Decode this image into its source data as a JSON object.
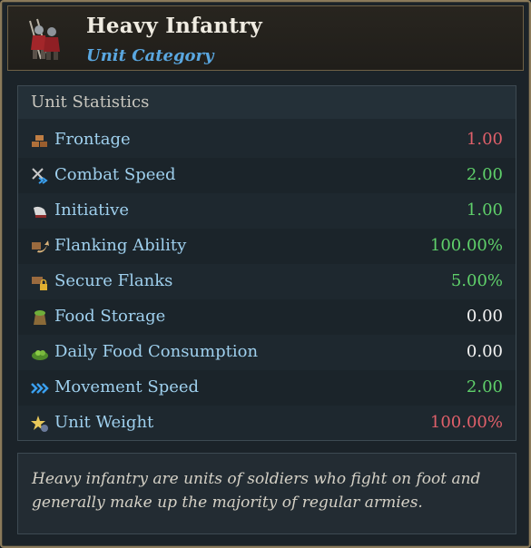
{
  "header": {
    "title": "Heavy Infantry",
    "subtitle": "Unit Category",
    "icon": "heavy-infantry-soldiers-icon"
  },
  "stats": {
    "heading": "Unit Statistics",
    "rows": [
      {
        "label": "Frontage",
        "value": "1.00",
        "value_color": "#e0606a",
        "icon": "frontage-icon"
      },
      {
        "label": "Combat Speed",
        "value": "2.00",
        "value_color": "#5fd06a",
        "icon": "combat-speed-icon"
      },
      {
        "label": "Initiative",
        "value": "1.00",
        "value_color": "#5fd06a",
        "icon": "initiative-icon"
      },
      {
        "label": "Flanking Ability",
        "value": "100.00%",
        "value_color": "#5fd06a",
        "icon": "flanking-ability-icon"
      },
      {
        "label": "Secure Flanks",
        "value": "5.00%",
        "value_color": "#5fd06a",
        "icon": "secure-flanks-icon"
      },
      {
        "label": "Food Storage",
        "value": "0.00",
        "value_color": "#f2f2f2",
        "icon": "food-storage-icon"
      },
      {
        "label": "Daily Food Consumption",
        "value": "0.00",
        "value_color": "#f2f2f2",
        "icon": "food-consumption-icon"
      },
      {
        "label": "Movement Speed",
        "value": "2.00",
        "value_color": "#5fd06a",
        "icon": "movement-speed-icon"
      },
      {
        "label": "Unit Weight",
        "value": "100.00%",
        "value_color": "#e0606a",
        "icon": "unit-weight-icon"
      }
    ]
  },
  "description": "Heavy infantry are units of soldiers who fight on foot and generally make up the majority of regular armies.",
  "colors": {
    "label": "#9fd0ee",
    "subtitle": "#5aa7e0",
    "positive": "#5fd06a",
    "negative": "#e0606a",
    "neutral": "#f2f2f2"
  }
}
